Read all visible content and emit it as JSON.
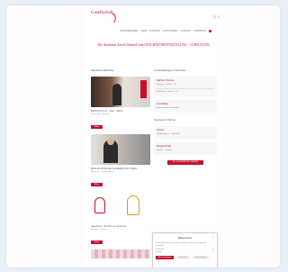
{
  "site": {
    "logo_text": "Gesellschaft"
  },
  "top_icons": [
    "Q",
    "≡"
  ],
  "nav": {
    "items": [
      "UNTERNEHMEN",
      "TEAM",
      "DIENSTE",
      "LEISTUNGEN",
      "KONTAKT",
      "KARRIERE"
    ]
  },
  "headline": "Die Akademie Zacchi Schmid Lehr GESCHÄFTSENTWICKLUNG · CONSULTING",
  "left_column": {
    "title": "Aktuelles & Berichte",
    "posts": [
      {
        "meta": "BERICHTE 24.11 · 2024 · NEWS",
        "excerpt": "Kurzbericht · Auszug",
        "button": "Mehr"
      },
      {
        "meta": "EINE KEYNOTE DER AKADEMIE ZUM THEMA",
        "excerpt": "Akademie · Veranstaltung",
        "button": "Mehr"
      },
      {
        "meta": "Gala Abend · Berichte und Eindrücke",
        "excerpt": "Rückblick · Event",
        "button": "Mehr"
      }
    ]
  },
  "right_column": {
    "title": "Veranstaltungen & Seminare",
    "blocks": [
      {
        "title": "Nächste Termine",
        "lines": [
          "Seminar · Datum · Ort",
          "Workshop · Datum · Ort"
        ]
      },
      {
        "title": "Anmeldung",
        "lines": [
          "Informationen & Formular"
        ]
      }
    ],
    "title2": "Netzwerk & Partner",
    "blocks2": [
      {
        "title": "Partner",
        "lines": [
          "Kooperationen · Verbände"
        ]
      },
      {
        "title": "Mitgliedschaft",
        "lines": [
          "Vorteile · Kontakt"
        ]
      }
    ],
    "wide_button": "ALLE VERANSTALTUNGEN"
  },
  "cookie_banner": {
    "title": "Datenschutz",
    "close": "×",
    "text": "Wir nutzen Cookies auf unserer Website. Einige von ihnen sind essenziell.",
    "rows": [
      "Essenziell",
      "Statistik"
    ],
    "accept": "Alle akzeptieren",
    "save": "Speichern",
    "more": "Einstellungen"
  },
  "colors": {
    "brand": "#c8102e",
    "background": "#e9eef8"
  }
}
